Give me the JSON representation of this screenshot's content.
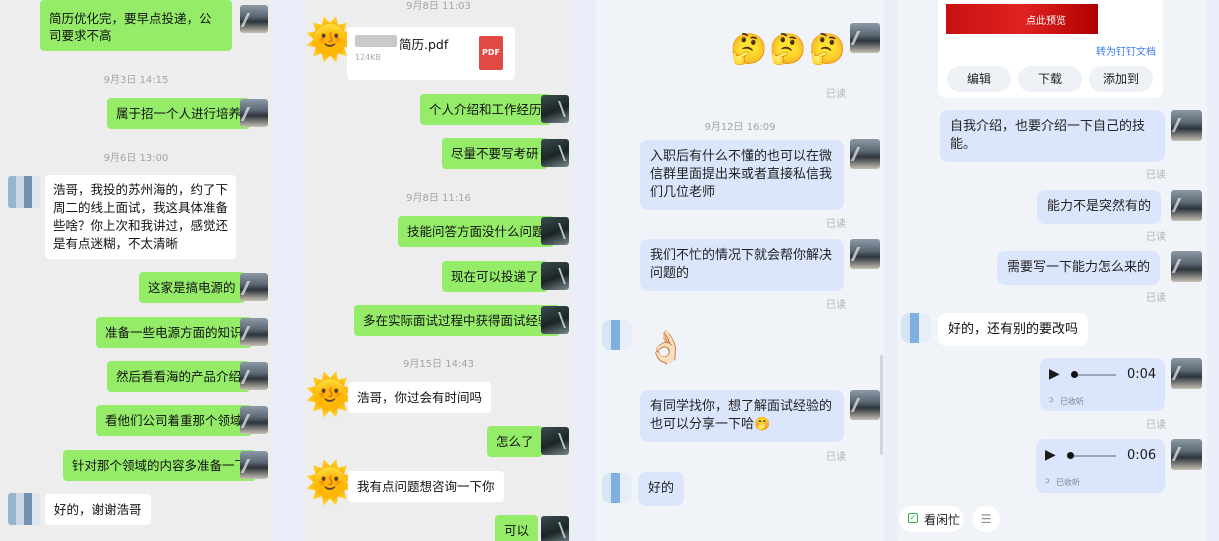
{
  "panel1": {
    "messages": [
      "简历优化完，要早点投递，公司要求不高",
      "属于招一个人进行培养",
      "浩哥，我投的苏州海的，约了下周二的线上面试，我这具体准备些啥？你上次和我讲过，感觉还是有点迷糊，不太清晰",
      "这家是搞电源的",
      "准备一些电源方面的知识",
      "然后看看海的产品介绍",
      "看他们公司着重那个领域",
      "针对那个领域的内容多准备一下",
      "好的，谢谢浩哥"
    ],
    "timestamps": [
      "9月3日 14:15",
      "9月6日 13:00"
    ]
  },
  "panel2": {
    "timestamps": [
      "9月8日 11:03",
      "9月8日 11:16",
      "9月15日 14:43"
    ],
    "file": {
      "name": "简历.pdf",
      "size": "124KB",
      "icon_label": "PDF"
    },
    "messages": [
      "个人介绍和工作经历",
      "尽量不要写考研",
      "技能问答方面没什么问题",
      "现在可以投递了",
      "多在实际面试过程中获得面试经验",
      "浩哥，你过会有时间吗",
      "怎么了",
      "我有点问题想咨询一下你",
      "可以"
    ]
  },
  "panel3": {
    "emoji_row": "🤔🤔🤔",
    "timestamp": "9月12日 16:09",
    "read_label": "已读",
    "messages": [
      "入职后有什么不懂的也可以在微信群里面提出来或者直接私信我们几位老师",
      "我们不忙的情况下就会帮你解决问题的",
      "有同学找你，想了解面试经验的也可以分享一下哈🤭",
      "好的"
    ],
    "ok_emoji": "👌🏻"
  },
  "panel4": {
    "preview_label": "点此预览",
    "convert_link": "转为钉钉文档",
    "actions": [
      "编辑",
      "下载",
      "添加到"
    ],
    "messages": [
      "自我介绍，也要介绍一下自己的技能。",
      "能力不是突然有的",
      "需要写一下能力怎么来的",
      "好的，还有别的要改吗"
    ],
    "read_label": "已读",
    "voices": [
      {
        "duration": "0:04",
        "status": "已收听"
      },
      {
        "duration": "0:06",
        "status": "已收听"
      }
    ],
    "bottom_button": "看闲忙",
    "menu_icon": "☰"
  },
  "colors": {
    "wechat_green": "#95ec69",
    "dingtalk_blue": "#dbe6fd"
  }
}
